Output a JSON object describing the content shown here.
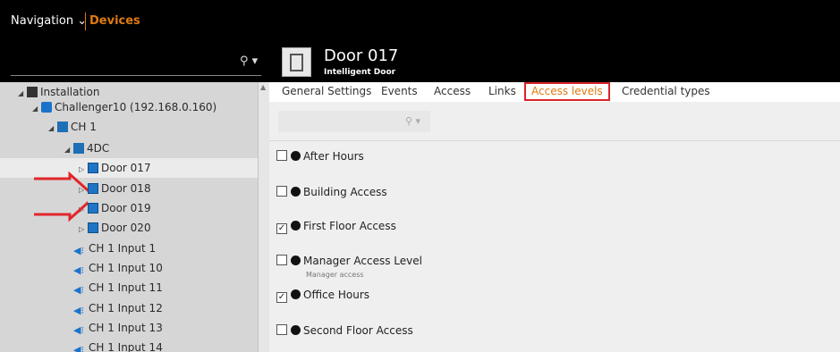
{
  "topbar": {
    "nav_label": "Navigation",
    "crumb": "Devices"
  },
  "device": {
    "title": "Door 017",
    "subtitle": "Intelligent Door"
  },
  "tree": {
    "items": [
      {
        "label": "Installation"
      },
      {
        "label": "Challenger10 (192.168.0.160)"
      },
      {
        "label": "CH 1"
      },
      {
        "label": "4DC"
      },
      {
        "label": "Door 017"
      },
      {
        "label": "Door 018"
      },
      {
        "label": "Door 019"
      },
      {
        "label": "Door 020"
      },
      {
        "label": "CH 1 Input 1"
      },
      {
        "label": "CH 1 Input 10"
      },
      {
        "label": "CH 1 Input 11"
      },
      {
        "label": "CH 1 Input 12"
      },
      {
        "label": "CH 1 Input 13"
      },
      {
        "label": "CH 1 Input 14"
      }
    ]
  },
  "tabs": [
    {
      "label": "General Settings"
    },
    {
      "label": "Events"
    },
    {
      "label": "Access"
    },
    {
      "label": "Links"
    },
    {
      "label": "Access levels"
    },
    {
      "label": "Credential types"
    }
  ],
  "active_tab": "Access levels",
  "access_levels": [
    {
      "label": "After Hours",
      "checked": false
    },
    {
      "label": "Building Access",
      "checked": false
    },
    {
      "label": "First Floor Access",
      "checked": true
    },
    {
      "label": "Manager Access Level",
      "checked": false,
      "sub": "Manager access"
    },
    {
      "label": "Office Hours",
      "checked": true
    },
    {
      "label": "Second Floor Access",
      "checked": false
    }
  ],
  "colors": {
    "accent": "#e07a10",
    "highlight_border": "#d9242b",
    "annotation_arrow": "#e0262b"
  }
}
